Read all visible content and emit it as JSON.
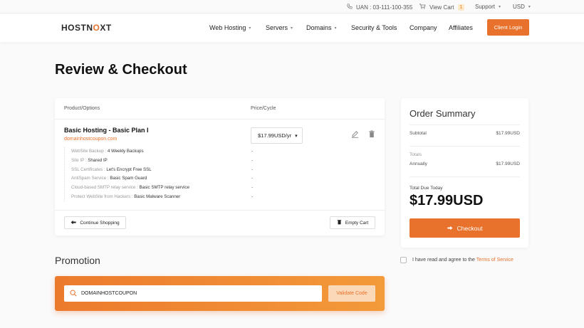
{
  "topbar": {
    "phone": "UAN : 03-111-100-355",
    "view_cart": "View Cart",
    "cart_count": "1",
    "support": "Support",
    "currency": "USD"
  },
  "header": {
    "logo_host": "HOST",
    "logo_n": "N",
    "logo_ext": "XT",
    "logo_o": "O",
    "nav": [
      "Web Hosting",
      "Servers",
      "Domains",
      "Security & Tools",
      "Company",
      "Affiliates"
    ],
    "client_login": "Client Login"
  },
  "page_title": "Review & Checkout",
  "cart": {
    "col_product": "Product/Options",
    "col_price": "Price/Cycle",
    "product_name": "Basic Hosting - Basic Plan I",
    "product_domain": "domainhostcoupon.com",
    "cycle_value": "$17.99USD/yr",
    "options": [
      {
        "label": "WebSite Backup :",
        "value": "4 Weekly Backups",
        "price": "-"
      },
      {
        "label": "Site IP :",
        "value": "Shared IP",
        "price": "-"
      },
      {
        "label": "SSL Certificates :",
        "value": "Let's Encrypt Free SSL",
        "price": "-"
      },
      {
        "label": "AntiSpam Service :",
        "value": "Basic Spam Guard",
        "price": "-"
      },
      {
        "label": "Cloud-based SMTP relay service :",
        "value": "Basic SMTP relay service",
        "price": "-"
      },
      {
        "label": "Protect WebSite from Hackers :",
        "value": "Basic Malware Scanner",
        "price": "-"
      }
    ],
    "continue_shopping": "Continue Shopping",
    "empty_cart": "Empty Cart"
  },
  "summary": {
    "title": "Order Summary",
    "subtotal_label": "Subtotal",
    "subtotal_value": "$17.99USD",
    "totals_label": "Totals",
    "annually_label": "Annually",
    "annually_value": "$17.99USD",
    "total_due_label": "Total Due Today",
    "total_due_value": "$17.99USD",
    "checkout": "Checkout"
  },
  "agree": {
    "text": "I have read and agree to the",
    "tos": "Terms of Service"
  },
  "promotion": {
    "title": "Promotion",
    "code_value": "DOMAINHOSTCOUPON",
    "validate": "Validate Code"
  },
  "colors": {
    "accent": "#e8722c"
  }
}
